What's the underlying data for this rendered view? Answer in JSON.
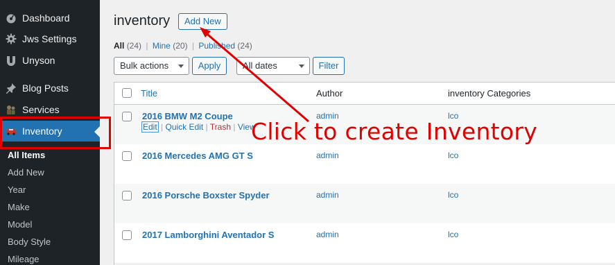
{
  "sidebar": {
    "items": [
      {
        "label": "Dashboard",
        "icon": "dashboard-icon"
      },
      {
        "label": "Jws Settings",
        "icon": "gear-icon"
      },
      {
        "label": "Unyson",
        "icon": "unyson-icon"
      },
      {
        "label": "Blog Posts",
        "icon": "pin-icon"
      },
      {
        "label": "Services",
        "icon": "services-icon"
      },
      {
        "label": "Inventory",
        "icon": "car-icon",
        "active": true
      }
    ],
    "submenu": [
      "All Items",
      "Add New",
      "Year",
      "Make",
      "Model",
      "Body Style",
      "Mileage"
    ]
  },
  "header": {
    "title": "inventory",
    "add_new_label": "Add New"
  },
  "filters": {
    "all_label": "All",
    "all_count": "(24)",
    "separator": "|",
    "mine_label": "Mine",
    "mine_count": "(20)",
    "published_label": "Published",
    "published_count": "(24)"
  },
  "actions": {
    "bulk_actions": "Bulk actions",
    "apply_label": "Apply",
    "all_dates": "All dates",
    "filter_label": "Filter"
  },
  "table": {
    "columns": [
      "Title",
      "Author",
      "inventory Categories"
    ],
    "rows": [
      {
        "title": "2016 BMW M2 Coupe",
        "author": "admin",
        "category": "lco"
      },
      {
        "title": "2016 Mercedes AMG GT S",
        "author": "admin",
        "category": "lco"
      },
      {
        "title": "2016 Porsche Boxster Spyder",
        "author": "admin",
        "category": "lco"
      },
      {
        "title": "2017 Lamborghini Aventador S",
        "author": "admin",
        "category": "lco"
      }
    ],
    "row_actions": {
      "edit": "Edit",
      "sep": "|",
      "quick_edit": "Quick Edit",
      "trash": "Trash",
      "view": "View"
    }
  },
  "annotation": {
    "text": "Click to create Inventory",
    "color": "#e00000"
  },
  "colors": {
    "sidebar_bg": "#1d2327",
    "accent": "#2271b1",
    "trash": "#b32d2e"
  }
}
